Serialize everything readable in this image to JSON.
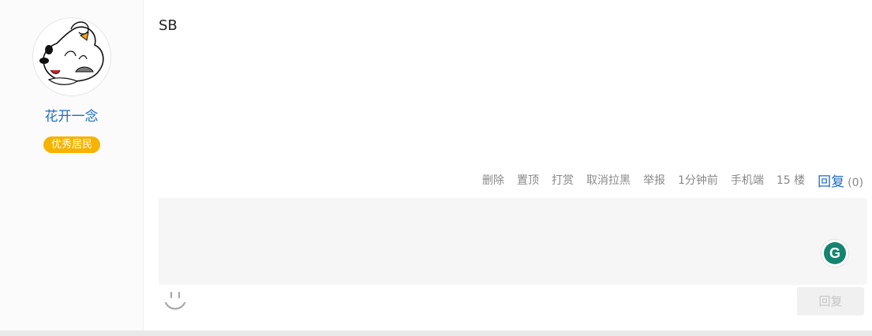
{
  "user": {
    "name": "花开一念",
    "badge": "优秀居民",
    "avatar_icon": "cartoon-dog-avatar"
  },
  "post": {
    "content": "SB"
  },
  "actions": {
    "delete": "删除",
    "pin": "置顶",
    "tip": "打赏",
    "unblock": "取消拉黑",
    "report": "举报",
    "time": "1分钟前",
    "device": "手机端",
    "floor": "15 楼",
    "reply": "回复",
    "reply_count": "(0)"
  },
  "reply_box": {
    "placeholder": "",
    "submit_label": "回复",
    "emoji_icon": "smiley-icon",
    "assistant_icon": "grammarly-icon",
    "assistant_letter": "G"
  },
  "colors": {
    "link": "#1e6cc4",
    "badge": "#f6b301",
    "muted": "#888888",
    "assistant": "#15846f"
  }
}
